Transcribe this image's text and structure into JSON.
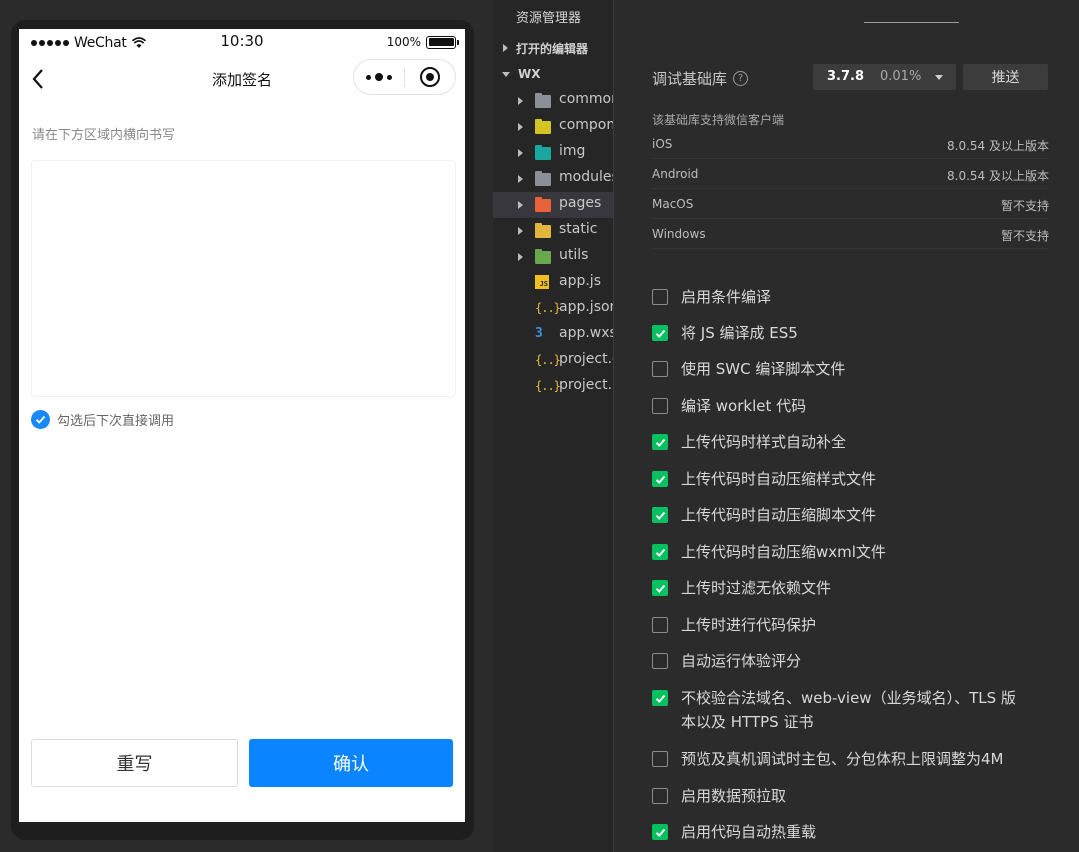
{
  "simulator": {
    "status": {
      "carrier": "WeChat",
      "time": "10:30",
      "battery": "100%"
    },
    "nav_title": "添加签名",
    "hint": "请在下方区域内横向书写",
    "remember_label": "勾选后下次直接调用",
    "remember_checked": true,
    "rewrite_label": "重写",
    "confirm_label": "确认"
  },
  "explorer": {
    "title": "资源管理器",
    "open_editors_label": "打开的编辑器",
    "project_label": "WX",
    "items": [
      {
        "name": "common",
        "type": "folder",
        "icon": "folder-icon",
        "color": "#8a8f98"
      },
      {
        "name": "components",
        "type": "folder",
        "icon": "components-folder-icon",
        "color": "#d4c324"
      },
      {
        "name": "img",
        "type": "folder",
        "icon": "images-folder-icon",
        "color": "#1aa7a0"
      },
      {
        "name": "modules",
        "type": "folder",
        "icon": "folder-icon",
        "color": "#8a8f98"
      },
      {
        "name": "pages",
        "type": "folder",
        "icon": "pages-folder-icon",
        "color": "#e8613a",
        "selected": true
      },
      {
        "name": "static",
        "type": "folder",
        "icon": "static-folder-icon",
        "color": "#e0b73a"
      },
      {
        "name": "utils",
        "type": "folder",
        "icon": "utils-folder-icon",
        "color": "#6aa84f"
      },
      {
        "name": "app.js",
        "type": "file",
        "icon": "js-file-icon"
      },
      {
        "name": "app.json",
        "type": "file",
        "icon": "json-file-icon"
      },
      {
        "name": "app.wxss",
        "type": "file",
        "icon": "css-file-icon"
      },
      {
        "name": "project.config.json",
        "type": "file",
        "icon": "json-file-icon"
      },
      {
        "name": "project.private.config.json",
        "type": "file",
        "icon": "json-file-icon"
      }
    ]
  },
  "settings": {
    "lib_label": "调试基础库",
    "lib_version": "3.7.8",
    "lib_percent": "0.01%",
    "push_label": "推送",
    "support_title": "该基础库支持微信客户端",
    "support": [
      {
        "os": "iOS",
        "status": "8.0.54 及以上版本"
      },
      {
        "os": "Android",
        "status": "8.0.54 及以上版本"
      },
      {
        "os": "MacOS",
        "status": "暂不支持"
      },
      {
        "os": "Windows",
        "status": "暂不支持"
      }
    ],
    "options": [
      {
        "label": "启用条件编译",
        "checked": false
      },
      {
        "label": "将 JS 编译成 ES5",
        "checked": true
      },
      {
        "label": "使用 SWC 编译脚本文件",
        "checked": false
      },
      {
        "label": "编译 worklet 代码",
        "checked": false
      },
      {
        "label": "上传代码时样式自动补全",
        "checked": true
      },
      {
        "label": "上传代码时自动压缩样式文件",
        "checked": true
      },
      {
        "label": "上传代码时自动压缩脚本文件",
        "checked": true
      },
      {
        "label": "上传代码时自动压缩wxml文件",
        "checked": true
      },
      {
        "label": "上传时过滤无依赖文件",
        "checked": true
      },
      {
        "label": "上传时进行代码保护",
        "checked": false
      },
      {
        "label": "自动运行体验评分",
        "checked": false
      },
      {
        "label": "不校验合法域名、web-view（业务域名）、TLS 版本以及 HTTPS 证书",
        "checked": true
      },
      {
        "label": "预览及真机调试时主包、分包体积上限调整为4M",
        "checked": false
      },
      {
        "label": "启用数据预拉取",
        "checked": false
      },
      {
        "label": "启用代码自动热重载",
        "checked": true
      }
    ]
  }
}
